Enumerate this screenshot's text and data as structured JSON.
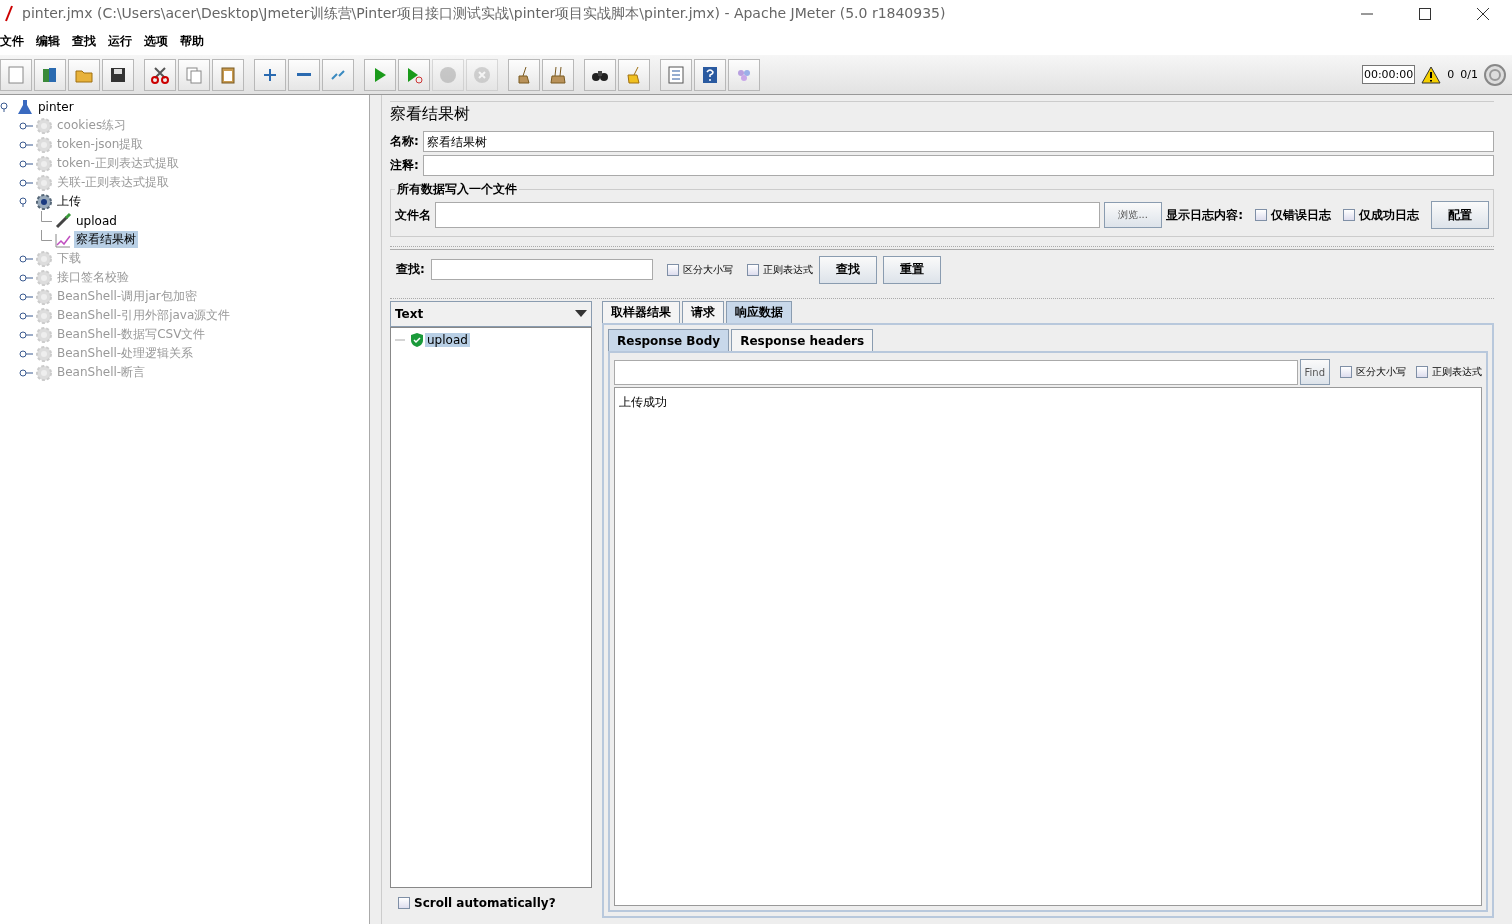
{
  "window": {
    "title": "pinter.jmx (C:\\Users\\acer\\Desktop\\Jmeter训练营\\Pinter项目接口测试实战\\pinter项目实战脚本\\pinter.jmx) - Apache JMeter (5.0 r1840935)"
  },
  "menu": [
    "文件",
    "编辑",
    "查找",
    "运行",
    "选项",
    "帮助"
  ],
  "toolbar": {
    "groups": [
      [
        {
          "kind": "new",
          "disabled": false
        },
        {
          "kind": "templates",
          "disabled": false
        },
        {
          "kind": "open",
          "disabled": false
        },
        {
          "kind": "save",
          "disabled": false
        }
      ],
      [
        {
          "kind": "cut",
          "disabled": false
        },
        {
          "kind": "copy",
          "disabled": false
        },
        {
          "kind": "paste",
          "disabled": false
        }
      ],
      [
        {
          "kind": "expand",
          "disabled": false
        },
        {
          "kind": "collapse",
          "disabled": false
        },
        {
          "kind": "toggle",
          "disabled": false
        }
      ],
      [
        {
          "kind": "start",
          "disabled": false
        },
        {
          "kind": "start-no-pause",
          "disabled": false
        },
        {
          "kind": "stop",
          "disabled": true
        },
        {
          "kind": "shutdown",
          "disabled": true
        }
      ],
      [
        {
          "kind": "clear",
          "disabled": false
        },
        {
          "kind": "clear-all",
          "disabled": false
        }
      ],
      [
        {
          "kind": "search",
          "disabled": false
        },
        {
          "kind": "reset-search",
          "disabled": false
        }
      ],
      [
        {
          "kind": "list",
          "disabled": false
        },
        {
          "kind": "help",
          "disabled": false
        },
        {
          "kind": "plugin",
          "disabled": false
        }
      ]
    ],
    "timer": "00:00:00",
    "warnings": "0",
    "threads": "0/1"
  },
  "tree": {
    "label": "pinter",
    "kind": "plan",
    "enabled": true,
    "selected": false,
    "expanded": true,
    "children": [
      {
        "label": "cookies练习",
        "kind": "group",
        "enabled": false,
        "selected": false,
        "expanded": false
      },
      {
        "label": "token-json提取",
        "kind": "group",
        "enabled": false,
        "selected": false,
        "expanded": false
      },
      {
        "label": "token-正则表达式提取",
        "kind": "group",
        "enabled": false,
        "selected": false,
        "expanded": false
      },
      {
        "label": "关联-正则表达式提取",
        "kind": "group",
        "enabled": false,
        "selected": false,
        "expanded": false
      },
      {
        "label": "上传",
        "kind": "group",
        "enabled": true,
        "selected": false,
        "expanded": true,
        "children": [
          {
            "label": "upload",
            "kind": "sampler",
            "enabled": true,
            "selected": false
          },
          {
            "label": "察看结果树",
            "kind": "listener",
            "enabled": true,
            "selected": true
          }
        ]
      },
      {
        "label": "下载",
        "kind": "group",
        "enabled": false,
        "selected": false,
        "expanded": false
      },
      {
        "label": "接口签名校验",
        "kind": "group",
        "enabled": false,
        "selected": false,
        "expanded": false
      },
      {
        "label": "BeanShell-调用jar包加密",
        "kind": "group",
        "enabled": false,
        "selected": false,
        "expanded": false
      },
      {
        "label": "BeanShell-引用外部java源文件",
        "kind": "group",
        "enabled": false,
        "selected": false,
        "expanded": false
      },
      {
        "label": "BeanShell-数据写CSV文件",
        "kind": "group",
        "enabled": false,
        "selected": false,
        "expanded": false
      },
      {
        "label": "BeanShell-处理逻辑关系",
        "kind": "group",
        "enabled": false,
        "selected": false,
        "expanded": false
      },
      {
        "label": "BeanShell-断言",
        "kind": "group",
        "enabled": false,
        "selected": false,
        "expanded": false
      }
    ]
  },
  "panel": {
    "title": "察看结果树",
    "name_label": "名称:",
    "name_value": "察看结果树",
    "comment_label": "注释:",
    "file_group": {
      "title": "所有数据写入一个文件",
      "file_label": "文件名",
      "browse_button": "浏览...",
      "log_label": "显示日志内容:",
      "checkboxes": [
        {
          "label": "仅错误日志",
          "checked": false
        },
        {
          "label": "仅成功日志",
          "checked": false
        }
      ],
      "config_button": "配置"
    },
    "search": {
      "label": "查找:",
      "checkboxes": [
        {
          "label": "区分大小写",
          "checked": false
        },
        {
          "label": "正则表达式",
          "checked": false
        }
      ],
      "find_button": "查找",
      "reset_button": "重置"
    }
  },
  "results": {
    "renderer": "Text",
    "items": [
      {
        "label": "upload",
        "selected": true
      }
    ],
    "scroll_auto": {
      "label": "Scroll automatically?",
      "checked": false
    }
  },
  "tabs": [
    {
      "label": "取样器结果",
      "selected": false
    },
    {
      "label": "请求",
      "selected": false
    },
    {
      "label": "响应数据",
      "selected": true
    }
  ],
  "subtabs": [
    {
      "label": "Response Body",
      "selected": true
    },
    {
      "label": "Response headers",
      "selected": false
    }
  ],
  "body_search": {
    "find_button": "Find",
    "checkboxes": [
      {
        "label": "区分大小写",
        "checked": false
      },
      {
        "label": "正则表达式",
        "checked": false
      }
    ]
  },
  "body": "上传成功"
}
